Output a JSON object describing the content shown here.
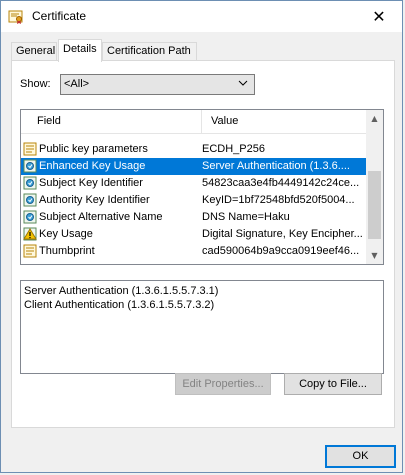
{
  "window": {
    "title": "Certificate",
    "close_glyph": "✕"
  },
  "tabs": [
    {
      "label": "General"
    },
    {
      "label": "Details"
    },
    {
      "label": "Certification Path"
    }
  ],
  "show": {
    "label": "Show:",
    "selected": "<All>"
  },
  "list": {
    "columns": {
      "field": "Field",
      "value": "Value"
    },
    "rows": [
      {
        "field": "Public key parameters",
        "value": "ECDH_P256",
        "icon": "certificate-field-icon",
        "selected": false
      },
      {
        "field": "Enhanced Key Usage",
        "value": "Server Authentication (1.3.6....",
        "icon": "extension-icon",
        "selected": true
      },
      {
        "field": "Subject Key Identifier",
        "value": "54823caa3e4fb4449142c24ce...",
        "icon": "extension-icon",
        "selected": false
      },
      {
        "field": "Authority Key Identifier",
        "value": "KeyID=1bf72548bfd520f5004...",
        "icon": "extension-icon",
        "selected": false
      },
      {
        "field": "Subject Alternative Name",
        "value": "DNS Name=Haku",
        "icon": "extension-icon",
        "selected": false
      },
      {
        "field": "Key Usage",
        "value": "Digital Signature, Key Encipher...",
        "icon": "warning-extension-icon",
        "selected": false
      },
      {
        "field": "Thumbprint",
        "value": "cad590064b9a9cca0919eef46...",
        "icon": "certificate-field-icon",
        "selected": false
      }
    ]
  },
  "detail": {
    "lines": [
      "Server Authentication (1.3.6.1.5.5.7.3.1)",
      "Client Authentication (1.3.6.1.5.5.7.3.2)"
    ]
  },
  "buttons": {
    "edit_properties": "Edit Properties...",
    "copy_to_file": "Copy to File...",
    "ok": "OK"
  },
  "colors": {
    "selection": "#0078d7",
    "accent": "#0078d7"
  }
}
